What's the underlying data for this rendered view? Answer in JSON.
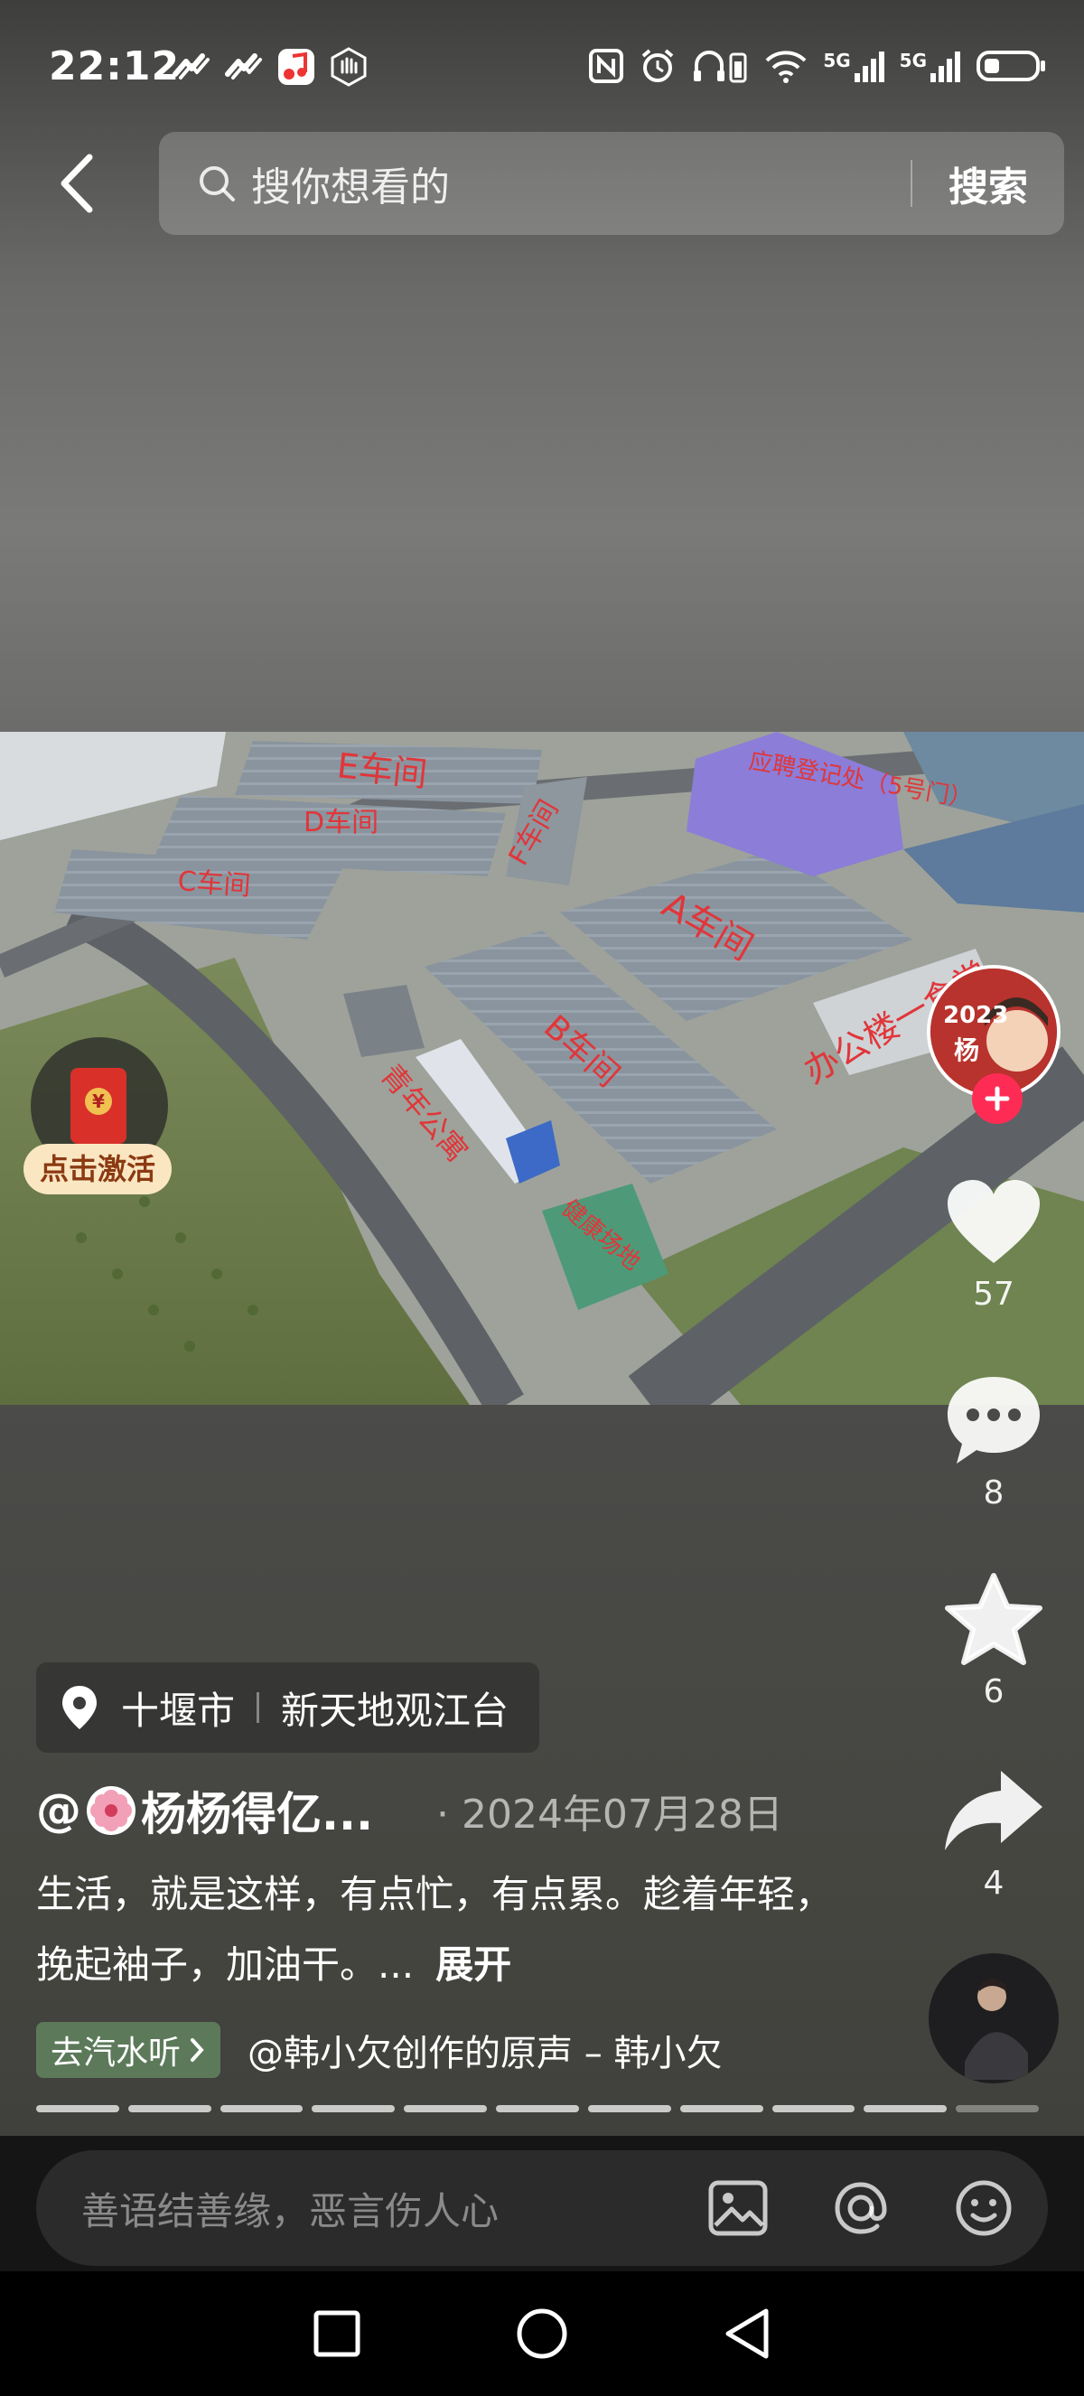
{
  "status_bar": {
    "time": "22:12",
    "left_icons": [
      "tiktok-icon",
      "tiktok-icon",
      "music-app-icon",
      "hand-icon"
    ],
    "right_icons": [
      "nfc-icon",
      "alarm-icon",
      "headphones-battery-icon",
      "wifi-icon",
      "signal-5g-icon",
      "signal-5g-icon",
      "battery-icon"
    ],
    "signal_label_1": "5G",
    "signal_label_2": "5G"
  },
  "search": {
    "placeholder": "搜你想看的",
    "submit_label": "搜索"
  },
  "video_map_labels": {
    "e": "E车间",
    "d": "D车间",
    "c": "C车间",
    "f": "F车间",
    "a": "A车间",
    "b": "B车间",
    "recruit": "应聘登记处（5号门）",
    "office": "办公楼一食堂",
    "dorm": "青年公寓",
    "sports": "健康场地"
  },
  "red_packet": {
    "label": "点击激活"
  },
  "author_avatar": {
    "badge": "2023",
    "name_char": "杨"
  },
  "actions": {
    "likes": "57",
    "comments": "8",
    "favorites": "6",
    "shares": "4"
  },
  "location": {
    "city": "十堰市",
    "place": "新天地观江台"
  },
  "post": {
    "author_prefix": "@",
    "author_name": "杨杨得亿...",
    "date": "· 2024年07月28日",
    "caption": "生活，就是这样，有点忙，有点累。趁着年轻，挽起袖子，加油干。...",
    "expand_label": "展开"
  },
  "music": {
    "chip_label": "去汽水听",
    "title": "@韩小欠创作的原声 – 韩小欠"
  },
  "progress": {
    "segments": 11,
    "active_segments": 10
  },
  "comment_bar": {
    "placeholder": "善语结善缘，恶言伤人心"
  },
  "colors": {
    "accent_red": "#fe2c55",
    "map_label_red": "#e0363a",
    "music_chip": "#5c7a5a"
  }
}
